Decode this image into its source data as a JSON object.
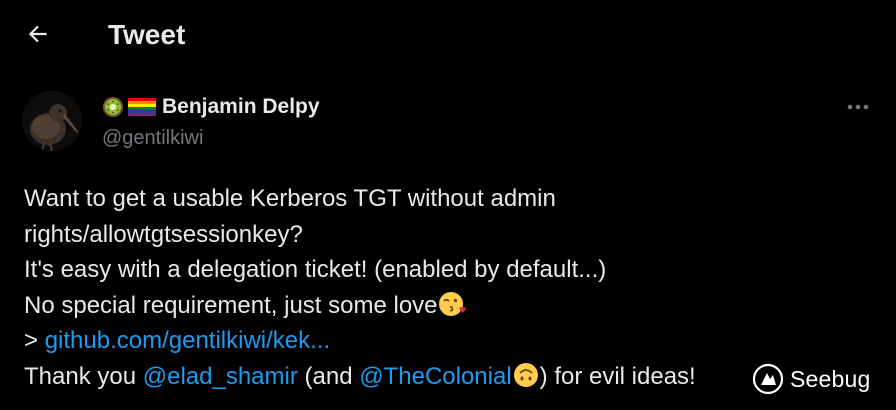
{
  "header": {
    "title": "Tweet",
    "back_icon": "arrow-left-icon"
  },
  "author": {
    "display_name": "Benjamin Delpy",
    "handle": "@gentilkiwi",
    "emojis": [
      "kiwi-emoji",
      "rainbow-flag-emoji"
    ],
    "avatar": "kiwi-bird-avatar"
  },
  "more_icon": "ellipsis-icon",
  "tweet": {
    "line1": "Want to get a usable Kerberos TGT without admin",
    "line2": "rights/allowtgtsessionkey?",
    "line3": "It's easy with a delegation ticket! (enabled by default...)",
    "line4": "No special requirement, just some love",
    "line4_emoji": "face-blowing-kiss-emoji",
    "line5_prefix": "> ",
    "line5_link": "github.com/gentilkiwi/kek...",
    "line6_text1": "Thank you ",
    "line6_mention1": "@elad_shamir",
    "line6_text2": " (and ",
    "line6_mention2": "@TheColonial",
    "line6_emoji": "upside-down-face-emoji",
    "line6_text3": ") for evil ideas!"
  },
  "watermark": {
    "label": "Seebug"
  },
  "colors": {
    "background": "#000000",
    "text": "#e7e9ea",
    "secondary": "#71767b",
    "link": "#1d9bf0"
  }
}
